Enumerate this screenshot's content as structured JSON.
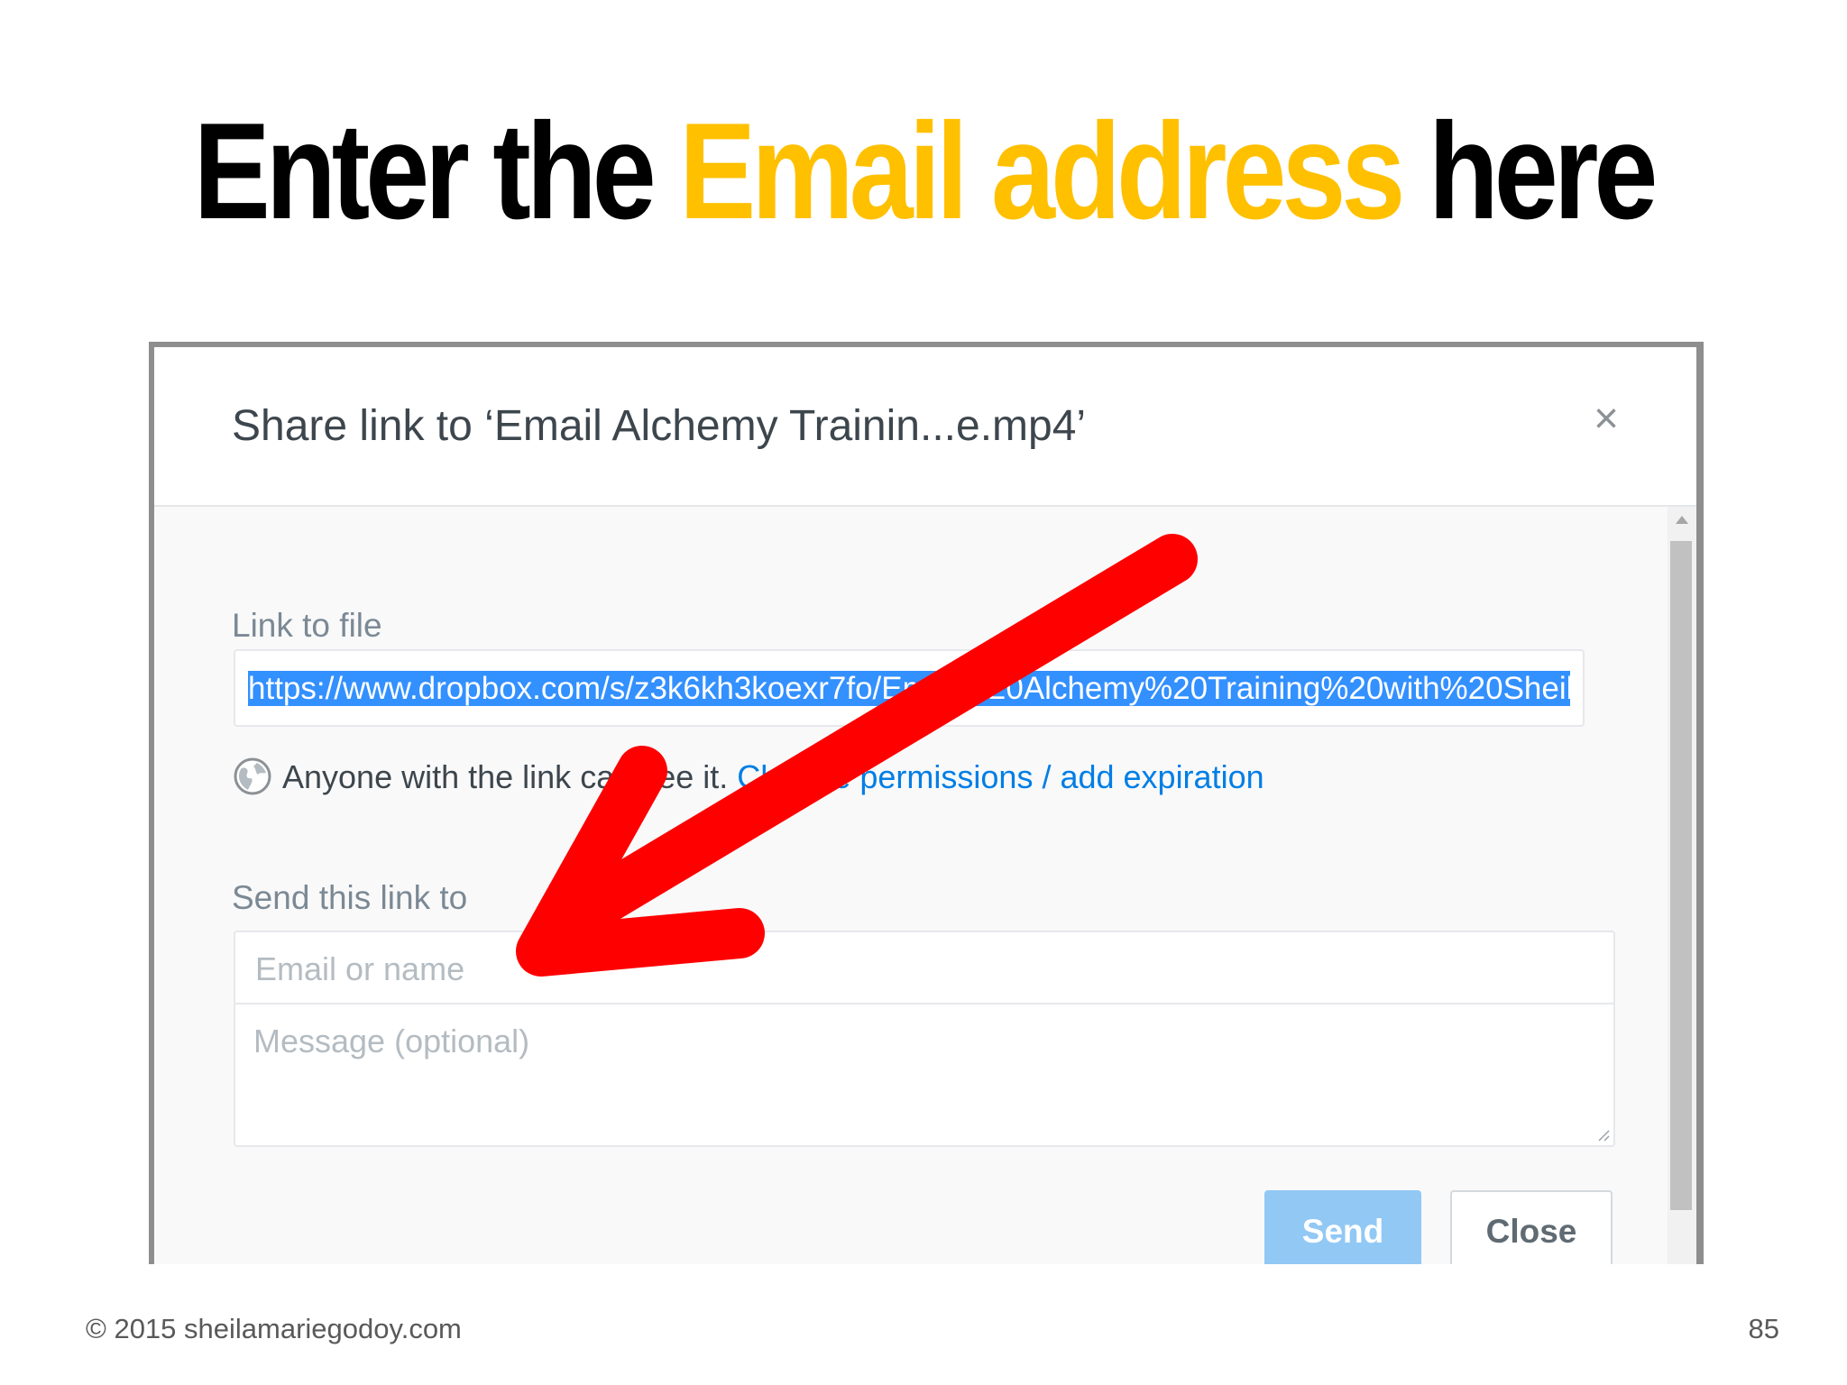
{
  "slide": {
    "title_before": "Enter the ",
    "title_highlight": "Email address",
    "title_after": " here",
    "highlight_color": "#ffc000",
    "footer_copyright": "© 2015 sheilamariegodoy.com",
    "page_number": "85"
  },
  "dialog": {
    "title": "Share link to ‘Email Alchemy Trainin...e.mp4’",
    "close_icon": "close-icon",
    "link_label": "Link to file",
    "link_url": "https://www.dropbox.com/s/z3k6kh3koexr7fo/Email%20Alchemy%20Training%20with%20Sheila",
    "permission_text": "Anyone with the link can see it. ",
    "permission_link": "Change permissions / add expiration",
    "send_label": "Send this link to",
    "email_placeholder": "Email or name",
    "message_placeholder": "Message (optional)",
    "send_button": "Send",
    "close_button": "Close"
  },
  "colors": {
    "accent_blue": "#007ee5",
    "send_button_bg": "#92c8f4",
    "selection_blue": "#3390ff",
    "arrow_red": "#ff0000"
  }
}
